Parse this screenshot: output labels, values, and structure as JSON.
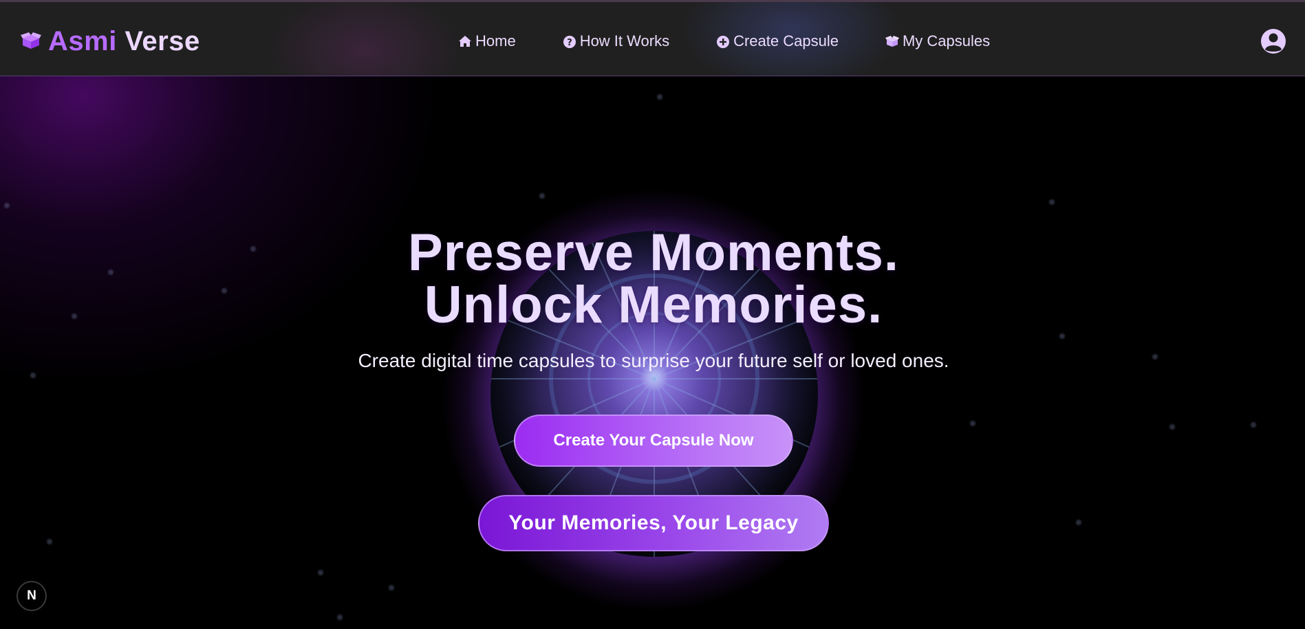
{
  "header": {
    "brand_part1": "Asmi",
    "brand_part2": "Verse",
    "brand_icon": "box-open-icon",
    "nav": [
      {
        "label": "Home",
        "icon": "home-icon"
      },
      {
        "label": "How It Works",
        "icon": "question-circle-icon"
      },
      {
        "label": "Create Capsule",
        "icon": "plus-circle-icon"
      },
      {
        "label": "My Capsules",
        "icon": "box-open-icon"
      }
    ],
    "user_icon": "user-circle-icon"
  },
  "hero": {
    "title_line1": "Preserve Moments.",
    "title_line2": "Unlock Memories.",
    "subtitle": "Create digital time capsules to surprise your future self or loved ones.",
    "cta_label": "Create Your Capsule Now",
    "tagline": "Your Memories, Your Legacy"
  },
  "dev_badge": {
    "label": "N"
  },
  "colors": {
    "accent": "#a855f7",
    "brand_light": "#ecd8ff",
    "navbar_bg": "#202020"
  }
}
